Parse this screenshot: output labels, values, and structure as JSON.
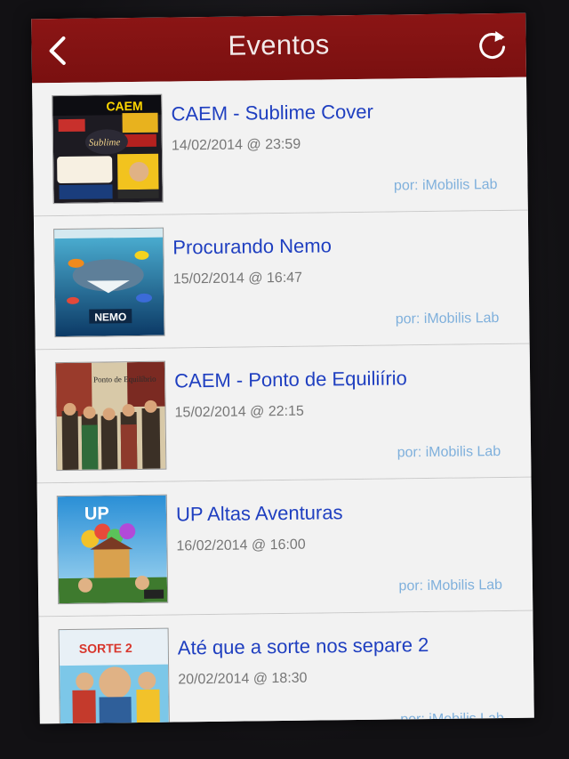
{
  "navbar": {
    "title": "Eventos",
    "back_icon": "chevron-left-icon",
    "refresh_icon": "refresh-icon",
    "color": "#801212"
  },
  "events": [
    {
      "title": "CAEM - Sublime Cover",
      "date": "14/02/2014 @ 23:59",
      "author": "por: iMobilis Lab",
      "poster_text": "Sublime"
    },
    {
      "title": "Procurando Nemo",
      "date": "15/02/2014 @ 16:47",
      "author": "por: iMobilis Lab",
      "poster_text": "NEMO"
    },
    {
      "title": "CAEM - Ponto de Equiliírio",
      "date": "15/02/2014 @ 22:15",
      "author": "por: iMobilis Lab",
      "poster_text": "Ponto de Equilíbrio"
    },
    {
      "title": "UP Altas Aventuras",
      "date": "16/02/2014 @ 16:00",
      "author": "por: iMobilis Lab",
      "poster_text": "UP"
    },
    {
      "title": "Até que a sorte nos separe 2",
      "date": "20/02/2014 @ 18:30",
      "author": "por: iMobilis Lab",
      "poster_text": "SORTE 2"
    }
  ]
}
